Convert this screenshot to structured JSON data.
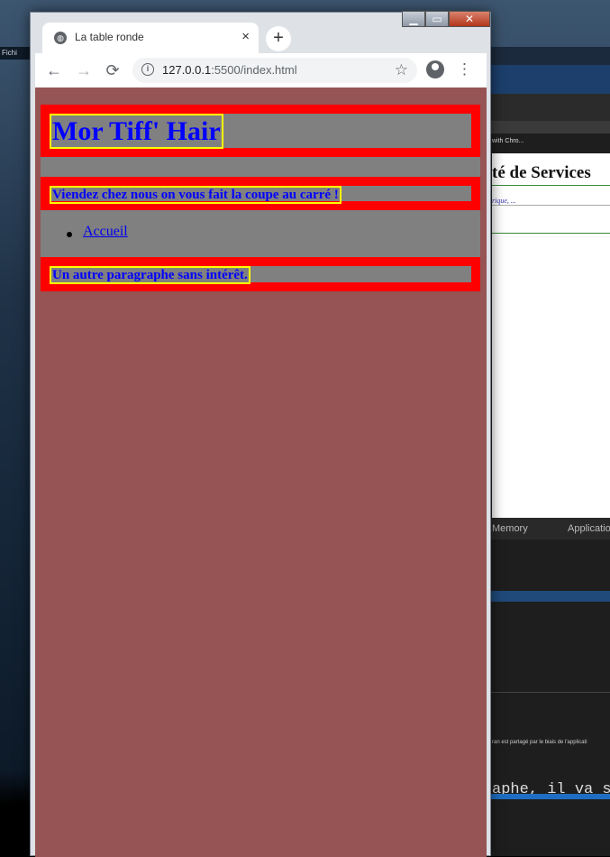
{
  "desktop": {
    "label": "Fichi"
  },
  "background_window": {
    "caption": "with Chro...",
    "heading": "té de Services",
    "sub_link": "rique, ...",
    "devtools_tabs": [
      "Memory",
      "Application"
    ],
    "share_notice": "ran est partagé par le biais de l'applicati",
    "code_text": "aphe, il va s"
  },
  "browser": {
    "tab_title": "La table ronde",
    "tab_close": "×",
    "new_tab": "+",
    "url_host": "127.0.0.1",
    "url_path": ":5500/index.html",
    "back": "←",
    "forward": "→",
    "reload": "⟳",
    "star": "☆",
    "menu": "⋮",
    "info": "i",
    "window_controls": {
      "minimize": "▁",
      "maximize": "▭",
      "close": "✕"
    }
  },
  "page": {
    "title": "Mor Tiff' Hair",
    "tagline": "Viendez chez nous on vous fait la coupe au carré !",
    "nav_items": [
      {
        "label": "Accueil"
      }
    ],
    "paragraph": "Un autre paragraphe sans intérêt."
  },
  "colors": {
    "page_background": "#965454",
    "box_background": "#808080",
    "box_border": "#ff0000",
    "text_border": "#ffff00",
    "text_color": "#0000ff"
  }
}
